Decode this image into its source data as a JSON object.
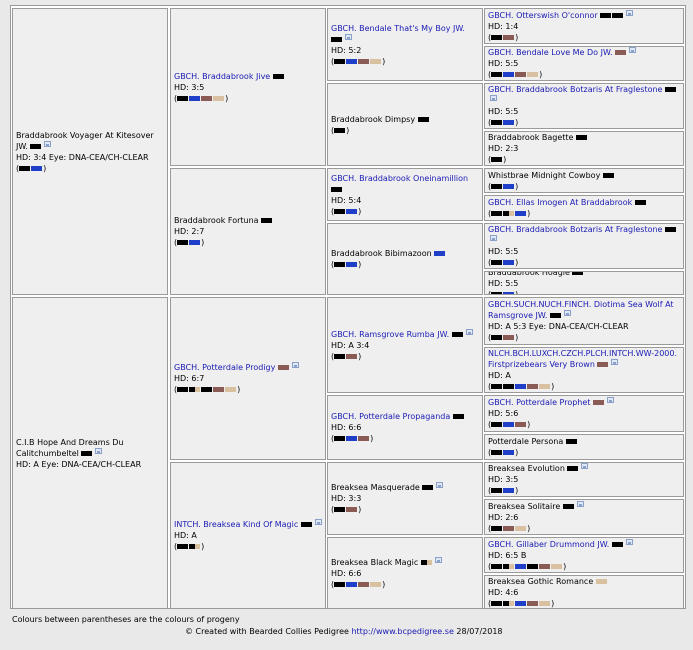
{
  "colors": {
    "black": "#000000",
    "blue": "#1f3fc8",
    "brown": "#8a5a55",
    "fawn": "#d8c0a0",
    "grey": "#7a7a7a"
  },
  "dogs": [
    {
      "id": "g1_1",
      "link": false,
      "name": "Braddabrook Voyager At Kitesover JW.",
      "name_swatches": [
        "black"
      ],
      "photo": true,
      "lines": [
        "HD: 3:4 Eye: DNA-CEA/CH-CLEAR"
      ],
      "progeny": [
        "black",
        "blue"
      ]
    },
    {
      "id": "g1_2",
      "link": false,
      "name": "C.I.B Hope And Dreams Du Calitchumbeltel",
      "name_swatches": [
        "black"
      ],
      "photo": true,
      "lines": [
        "HD: A Eye: DNA-CEA/CH-CLEAR"
      ],
      "progeny": []
    },
    {
      "id": "g2_1",
      "link": true,
      "name": "GBCH. Braddabrook Jive",
      "name_swatches": [
        "black"
      ],
      "photo": false,
      "lines": [
        "HD: 3:5"
      ],
      "progeny": [
        "black",
        "blue",
        "brown",
        "fawn"
      ]
    },
    {
      "id": "g2_2",
      "link": false,
      "name": "Braddabrook Fortuna",
      "name_swatches": [
        "black"
      ],
      "photo": false,
      "lines": [
        "HD: 2:7"
      ],
      "progeny": [
        "black",
        "blue"
      ]
    },
    {
      "id": "g2_3",
      "link": true,
      "name": "GBCH. Potterdale Prodigy",
      "name_swatches": [
        "brown"
      ],
      "photo": true,
      "lines": [
        "HD: 6:7"
      ],
      "progeny": [
        "black",
        "blackfawn",
        "black",
        "brown",
        "fawn"
      ]
    },
    {
      "id": "g2_4",
      "link": true,
      "name": "INTCH. Breaksea Kind Of Magic",
      "name_swatches": [
        "black"
      ],
      "photo": true,
      "lines": [
        "HD: A"
      ],
      "progeny": [
        "black",
        "blackfawn"
      ]
    },
    {
      "id": "g3_1",
      "link": true,
      "name": "GBCH. Bendale That's My Boy JW.",
      "name_swatches": [
        "black"
      ],
      "photo": true,
      "lines": [
        "HD: 5:2"
      ],
      "progeny": [
        "black",
        "blue",
        "brown",
        "fawn"
      ]
    },
    {
      "id": "g3_2",
      "link": false,
      "name": "Braddabrook Dimpsy",
      "name_swatches": [
        "black"
      ],
      "photo": false,
      "lines": [],
      "progeny": [
        "black"
      ]
    },
    {
      "id": "g3_3",
      "link": true,
      "name": "GBCH. Braddabrook Oneinamillion",
      "name_swatches": [
        "black"
      ],
      "photo": false,
      "lines": [
        "HD: 5:4"
      ],
      "progeny": [
        "black",
        "blue"
      ]
    },
    {
      "id": "g3_4",
      "link": false,
      "name": "Braddabrook Bibimazoon",
      "name_swatches": [
        "blue"
      ],
      "photo": false,
      "lines": [],
      "progeny": [
        "black",
        "blue"
      ]
    },
    {
      "id": "g3_5",
      "link": true,
      "name": "GBCH. Ramsgrove Rumba JW.",
      "name_swatches": [
        "black"
      ],
      "photo": true,
      "lines": [
        "HD: A 3:4"
      ],
      "progeny": [
        "black",
        "brown"
      ]
    },
    {
      "id": "g3_6",
      "link": true,
      "name": "GBCH. Potterdale Propaganda",
      "name_swatches": [
        "black"
      ],
      "photo": false,
      "lines": [
        "HD: 6:6"
      ],
      "progeny": [
        "black",
        "blue",
        "brown"
      ]
    },
    {
      "id": "g3_7",
      "link": false,
      "name": "Breaksea Masquerade",
      "name_swatches": [
        "black"
      ],
      "photo": true,
      "lines": [
        "HD: 3:3"
      ],
      "progeny": [
        "black",
        "brown"
      ]
    },
    {
      "id": "g3_8",
      "link": false,
      "name": "Breaksea Black Magic",
      "name_swatches": [
        "blackfawn"
      ],
      "photo": true,
      "lines": [
        "HD: 6:6"
      ],
      "progeny": [
        "black",
        "blue",
        "brown",
        "fawn"
      ]
    },
    {
      "id": "g4_1",
      "link": true,
      "name": "GBCH. Otterswish O'connor",
      "name_swatches": [
        "black",
        "black"
      ],
      "photo": true,
      "lines": [
        "HD: 1:4"
      ],
      "progeny": [
        "black",
        "brown"
      ]
    },
    {
      "id": "g4_2",
      "link": true,
      "name": "GBCH. Bendale Love Me Do JW.",
      "name_swatches": [
        "brown"
      ],
      "photo": true,
      "lines": [
        "HD: 5:5"
      ],
      "progeny": [
        "black",
        "blue",
        "brown",
        "fawn"
      ]
    },
    {
      "id": "g4_3",
      "link": true,
      "name": "GBCH. Braddabrook Botzaris At Fraglestone",
      "name_swatches": [
        "black"
      ],
      "photo": true,
      "lines": [
        "HD: 5:5"
      ],
      "progeny": [
        "black",
        "blue"
      ]
    },
    {
      "id": "g4_4",
      "link": false,
      "name": "Braddabrook Bagette",
      "name_swatches": [
        "black"
      ],
      "photo": false,
      "lines": [
        "HD: 2:3"
      ],
      "progeny": [
        "black"
      ]
    },
    {
      "id": "g4_5",
      "link": false,
      "name": "Whistbrae Midnight Cowboy",
      "name_swatches": [
        "black"
      ],
      "photo": false,
      "lines": [],
      "progeny": [
        "black",
        "blue"
      ]
    },
    {
      "id": "g4_6",
      "link": true,
      "name": "GBCH. Ellas Imogen At Braddabrook",
      "name_swatches": [
        "black"
      ],
      "photo": false,
      "lines": [],
      "progeny": [
        "black",
        "blackfawn",
        "blue"
      ]
    },
    {
      "id": "g4_7",
      "link": true,
      "name": "GBCH. Braddabrook Botzaris At Fraglestone",
      "name_swatches": [
        "black"
      ],
      "photo": true,
      "lines": [
        "HD: 5:5"
      ],
      "progeny": [
        "black",
        "blue"
      ]
    },
    {
      "id": "g4_8",
      "link": false,
      "name": "Braddabrook Hoagie",
      "name_swatches": [
        "black"
      ],
      "photo": false,
      "lines": [
        "HD: 5:5"
      ],
      "progeny": [
        "black",
        "blue"
      ]
    },
    {
      "id": "g4_9",
      "link": true,
      "name": "GBCH.SUCH.NUCH.FINCH. Diotima Sea Wolf At Ramsgrove JW.",
      "name_swatches": [
        "black"
      ],
      "photo": true,
      "lines": [
        "HD: A 5:3 Eye: DNA-CEA/CH-CLEAR"
      ],
      "progeny": [
        "black",
        "brown"
      ]
    },
    {
      "id": "g4_10",
      "link": true,
      "name": "NLCH.BCH.LUXCH.CZCH.PLCH.INTCH.WW-2000. Firstprizebears Very Brown",
      "name_swatches": [
        "brown"
      ],
      "photo": true,
      "lines": [
        "HD: A"
      ],
      "progeny": [
        "black",
        "black",
        "blue",
        "brown",
        "fawn"
      ]
    },
    {
      "id": "g4_11",
      "link": true,
      "name": "GBCH. Potterdale Prophet",
      "name_swatches": [
        "brown"
      ],
      "photo": true,
      "lines": [
        "HD: 5:6"
      ],
      "progeny": [
        "black",
        "blue",
        "brown"
      ]
    },
    {
      "id": "g4_12",
      "link": false,
      "name": "Potterdale Persona",
      "name_swatches": [
        "black"
      ],
      "photo": false,
      "lines": [],
      "progeny": [
        "black",
        "blue"
      ]
    },
    {
      "id": "g4_13",
      "link": false,
      "name": "Breaksea Evolution",
      "name_swatches": [
        "black"
      ],
      "photo": true,
      "lines": [
        "HD: 3:5"
      ],
      "progeny": [
        "black",
        "blue"
      ]
    },
    {
      "id": "g4_14",
      "link": false,
      "name": "Breaksea Solitaire",
      "name_swatches": [
        "black"
      ],
      "photo": true,
      "lines": [
        "HD: 2:6"
      ],
      "progeny": [
        "black",
        "brown",
        "fawn"
      ]
    },
    {
      "id": "g4_15",
      "link": true,
      "name": "GBCH. Gillaber Drummond JW.",
      "name_swatches": [
        "black"
      ],
      "photo": true,
      "lines": [
        "HD: 6:5 B"
      ],
      "progeny": [
        "black",
        "blackfawn",
        "blue",
        "black",
        "brown",
        "fawn"
      ]
    },
    {
      "id": "g4_16",
      "link": false,
      "name": "Breaksea Gothic Romance",
      "name_swatches": [
        "fawn"
      ],
      "photo": false,
      "lines": [
        "HD: 4:6"
      ],
      "progeny": [
        "black",
        "blackfawn",
        "blue",
        "brown",
        "fawn"
      ]
    }
  ],
  "footer": {
    "note": "Colours between parentheses are the colours of progeny",
    "credit_prefix": "© Created with Bearded Collies Pedigree",
    "credit_link": "http://www.bcpedigree.se",
    "credit_date": "28/07/2018"
  }
}
